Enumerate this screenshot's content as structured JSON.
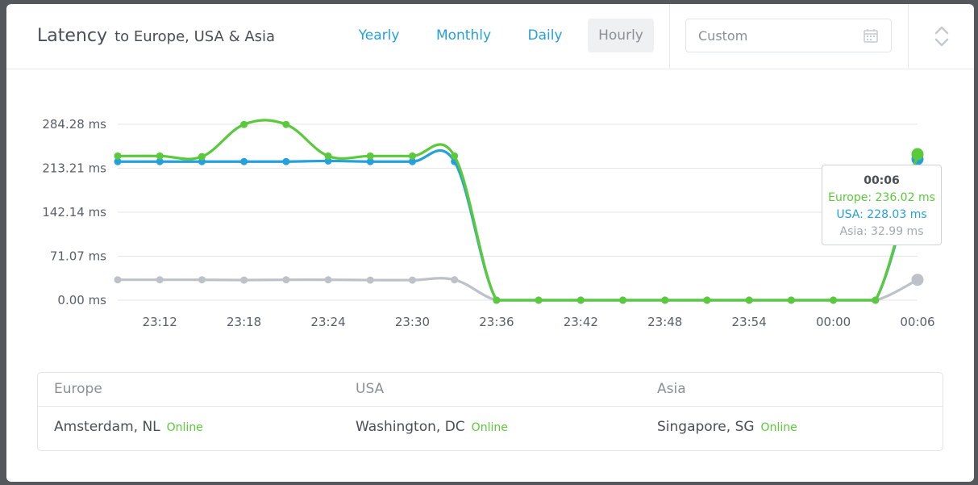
{
  "header": {
    "title": "Latency",
    "subtitle": "to Europe, USA & Asia",
    "periods": [
      {
        "label": "Yearly",
        "active": false
      },
      {
        "label": "Monthly",
        "active": false
      },
      {
        "label": "Daily",
        "active": false
      },
      {
        "label": "Hourly",
        "active": true
      }
    ],
    "custom_placeholder": "Custom",
    "icons": [
      "calendar-icon",
      "expand-collapse-icon"
    ]
  },
  "chart_data": {
    "type": "line",
    "x": [
      "23:10",
      "23:12",
      "23:15",
      "23:18",
      "23:21",
      "23:24",
      "23:27",
      "23:30",
      "23:33",
      "23:36",
      "23:39",
      "23:42",
      "23:45",
      "23:48",
      "23:51",
      "23:54",
      "23:57",
      "00:00",
      "00:03",
      "00:06"
    ],
    "x_tick_labels": [
      "23:12",
      "23:18",
      "23:24",
      "23:30",
      "23:36",
      "23:42",
      "23:48",
      "23:54",
      "00:00",
      "00:06"
    ],
    "y_tick_labels": [
      "0.00 ms",
      "71.07 ms",
      "142.14 ms",
      "213.21 ms",
      "284.28 ms"
    ],
    "ylim": [
      0,
      284.28
    ],
    "grid": true,
    "series": [
      {
        "name": "Europe",
        "color": "#5ac93a",
        "values": [
          233,
          233,
          232,
          284,
          284,
          233,
          233,
          233,
          233,
          0,
          0,
          0,
          0,
          0,
          0,
          0,
          0,
          0,
          0,
          236.02
        ]
      },
      {
        "name": "USA",
        "color": "#26a0da",
        "values": [
          224,
          224,
          224,
          224,
          224,
          225,
          224,
          224,
          224,
          0,
          0,
          0,
          0,
          0,
          0,
          0,
          0,
          0,
          0,
          228.03
        ]
      },
      {
        "name": "Asia",
        "color": "#bcc2c8",
        "values": [
          33,
          33,
          33,
          32.5,
          33,
          33,
          32.5,
          32.5,
          33,
          0,
          0,
          0,
          0,
          0,
          0,
          0,
          0,
          0,
          0,
          32.99
        ]
      }
    ],
    "tooltip": {
      "time": "00:06",
      "lines": [
        "Europe: 236.02 ms",
        "USA: 228.03 ms",
        "Asia: 32.99 ms"
      ]
    }
  },
  "locations": {
    "columns": [
      {
        "region": "Europe",
        "city": "Amsterdam, NL",
        "status": "Online"
      },
      {
        "region": "USA",
        "city": "Washington, DC",
        "status": "Online"
      },
      {
        "region": "Asia",
        "city": "Singapore, SG",
        "status": "Online"
      }
    ]
  }
}
